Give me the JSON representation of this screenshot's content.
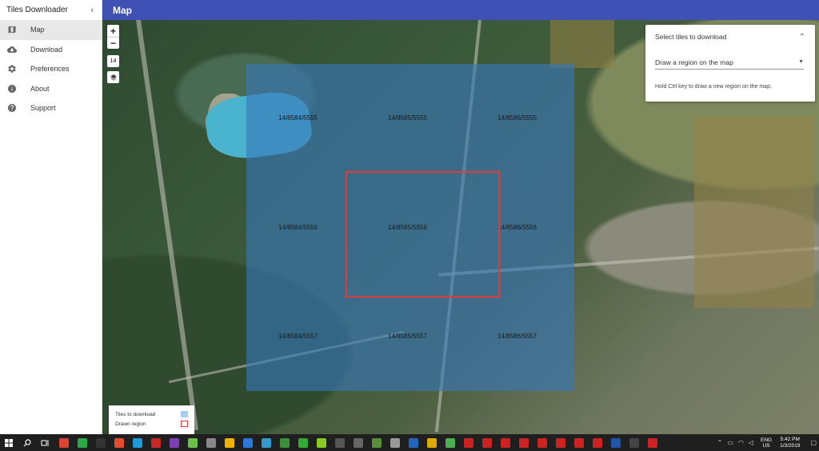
{
  "app": {
    "title": "Tiles Downloader",
    "collapse_glyph": "‹"
  },
  "sidebar": {
    "items": [
      {
        "label": "Map",
        "icon": "map-icon",
        "active": true
      },
      {
        "label": "Download",
        "icon": "cloud-download-icon"
      },
      {
        "label": "Preferences",
        "icon": "gear-icon"
      },
      {
        "label": "About",
        "icon": "info-icon"
      },
      {
        "label": "Support",
        "icon": "help-icon"
      }
    ]
  },
  "topbar": {
    "title": "Map"
  },
  "map": {
    "zoom_in": "+",
    "zoom_out": "−",
    "zoom_level": "14",
    "tiles": [
      "14/8584/5555",
      "14/8585/5555",
      "14/8586/5555",
      "14/8584/5556",
      "14/8585/5556",
      "14/8586/5556",
      "14/8584/5557",
      "14/8585/5557",
      "14/8586/5557"
    ]
  },
  "panel": {
    "title": "Select tiles to download",
    "chevron": "⌃",
    "select_value": "Draw a region on the map",
    "hint": "Hold Ctrl key to draw a new region on the map."
  },
  "legend": {
    "tiles_label": "Tiles to download",
    "region_label": "Drawn region"
  },
  "taskbar": {
    "lang_1": "ENG",
    "lang_2": "US",
    "time": "5:42 PM",
    "date": "1/3/2019",
    "apps": [
      "#dd4433",
      "#2aa84a",
      "#333333",
      "#e44c2c",
      "#1d9bd7",
      "#c62828",
      "#7b3fb5",
      "#6cc04a",
      "#888888",
      "#f0b400",
      "#2b78d9",
      "#3399cc",
      "#3a8f3a",
      "#33aa33",
      "#88cc22",
      "#555555",
      "#666666",
      "#5a8f3a",
      "#999999",
      "#2266bb",
      "#ddaa00",
      "#4caf50",
      "#cc2222",
      "#cc2222",
      "#cc2222",
      "#cc2222",
      "#cc2222",
      "#cc2222",
      "#cc2222",
      "#cc2222",
      "#2255aa",
      "#444444",
      "#cc2222"
    ]
  }
}
